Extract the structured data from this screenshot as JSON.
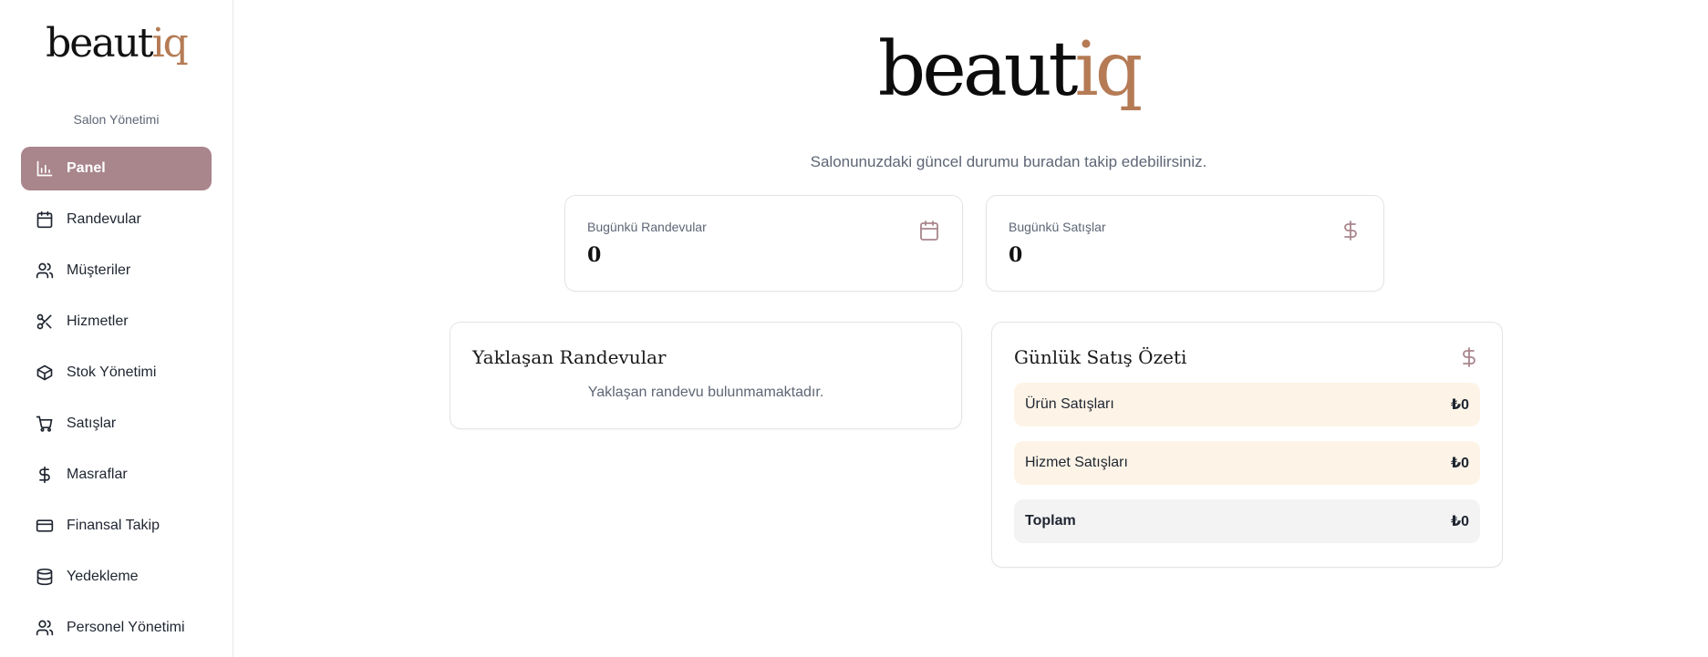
{
  "brand": {
    "name_main": "beaut",
    "name_accent": "iq",
    "accent_color": "#b57b55"
  },
  "sidebar": {
    "subtitle": "Salon Yönetimi",
    "items": [
      {
        "label": "Panel",
        "icon": "bar-chart-icon",
        "active": true
      },
      {
        "label": "Randevular",
        "icon": "calendar-icon"
      },
      {
        "label": "Müşteriler",
        "icon": "users-icon"
      },
      {
        "label": "Hizmetler",
        "icon": "scissors-icon"
      },
      {
        "label": "Stok Yönetimi",
        "icon": "package-icon"
      },
      {
        "label": "Satışlar",
        "icon": "cart-icon"
      },
      {
        "label": "Masraflar",
        "icon": "dollar-icon"
      },
      {
        "label": "Finansal Takip",
        "icon": "credit-card-icon"
      },
      {
        "label": "Yedekleme",
        "icon": "database-icon"
      },
      {
        "label": "Personel Yönetimi",
        "icon": "users-icon"
      }
    ],
    "active_color": "#a9858c"
  },
  "main": {
    "subtitle": "Salonunuzdaki güncel durumu buradan takip edebilirsiniz.",
    "stats": [
      {
        "label": "Bugünkü Randevular",
        "value": "0",
        "icon": "calendar-icon"
      },
      {
        "label": "Bugünkü Satışlar",
        "value": "0",
        "icon": "dollar-icon"
      }
    ],
    "upcoming": {
      "title": "Yaklaşan Randevular",
      "empty_text": "Yaklaşan randevu bulunmamaktadır."
    },
    "daily_sales": {
      "title": "Günlük Satış Özeti",
      "icon": "dollar-icon",
      "rows": [
        {
          "label": "Ürün Satışları",
          "amount": "₺0"
        },
        {
          "label": "Hizmet Satışları",
          "amount": "₺0"
        },
        {
          "label": "Toplam",
          "amount": "₺0"
        }
      ]
    }
  }
}
